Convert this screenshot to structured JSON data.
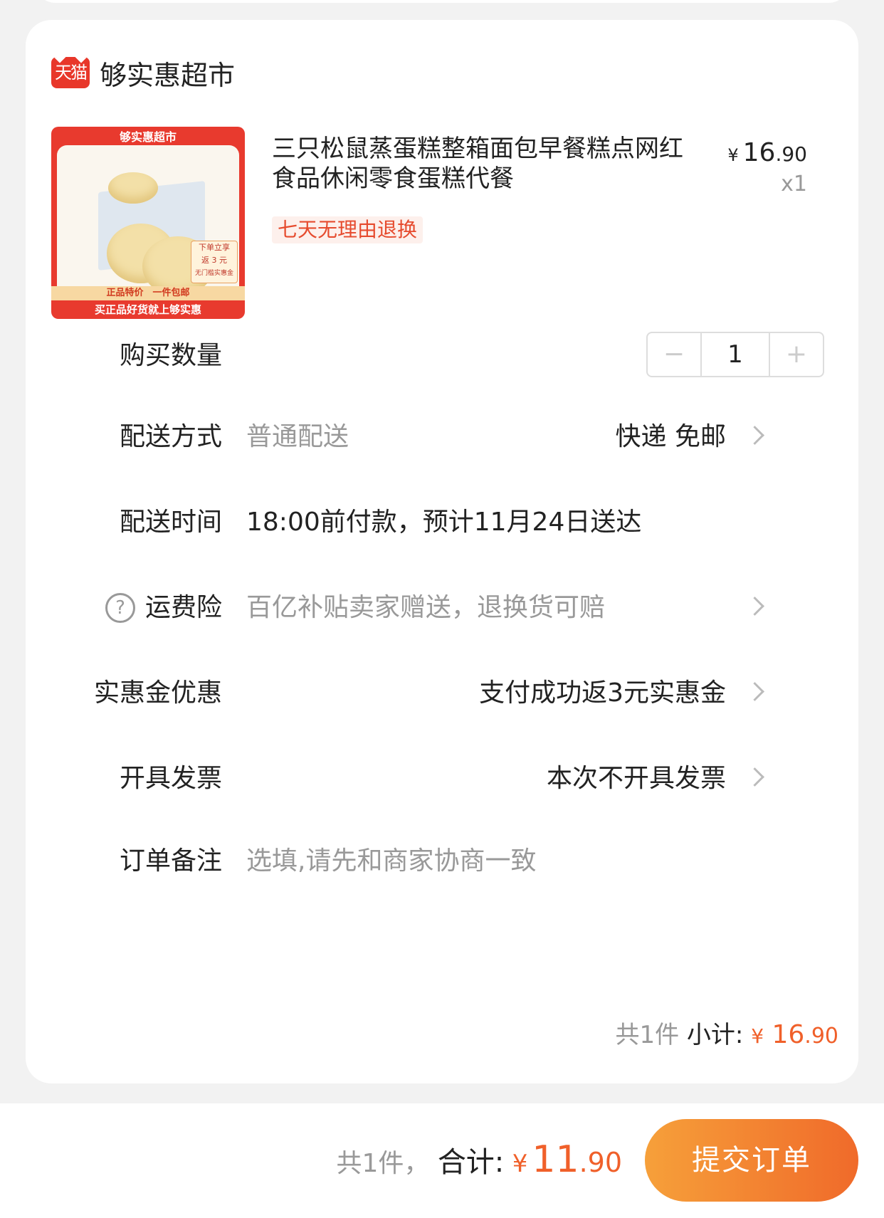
{
  "shop": {
    "platform_badge": "天猫",
    "name": "够实惠超市"
  },
  "product": {
    "thumb": {
      "header": "够实惠超市",
      "promo_line1": "下单立享",
      "promo_line2": "返 3 元",
      "promo_line3": "无门槛实惠金",
      "footer1": "正品特价　一件包邮",
      "footer2": "买正品好货就上够实惠"
    },
    "title": "三只松鼠蒸蛋糕整箱面包早餐糕点网红食品休闲零食蛋糕代餐",
    "price_yen": "¥",
    "price_int": "16",
    "price_cents": ".90",
    "quantity_label": "x1",
    "return_policy": "七天无理由退换"
  },
  "rows": {
    "quantity": {
      "label": "购买数量",
      "minus": "−",
      "value": "1",
      "plus": "+"
    },
    "delivery_method": {
      "label": "配送方式",
      "value": "普通配送",
      "right": "快递 免邮"
    },
    "delivery_time": {
      "label": "配送时间",
      "value": "18:00前付款，预计11月24日送达"
    },
    "shipping_insurance": {
      "label": "运费险",
      "help": "?",
      "value": "百亿补贴卖家赠送，退换货可赔"
    },
    "cashback": {
      "label": "实惠金优惠",
      "right": "支付成功返3元实惠金"
    },
    "invoice": {
      "label": "开具发票",
      "right": "本次不开具发票"
    },
    "note": {
      "label": "订单备注",
      "placeholder": "选填,请先和商家协商一致"
    }
  },
  "subtotal": {
    "count": "共1件",
    "label": "小计:",
    "yen": "¥",
    "int": "16",
    "cents": ".90"
  },
  "footer": {
    "count": "共1件，",
    "label": "合计:",
    "yen": "¥",
    "int": "11",
    "cents": ".90",
    "submit": "提交订单"
  },
  "colors": {
    "accent": "#f0602a",
    "tmall_red": "#e8372a",
    "button_start": "#f6a03a",
    "button_end": "#f06a2a"
  }
}
